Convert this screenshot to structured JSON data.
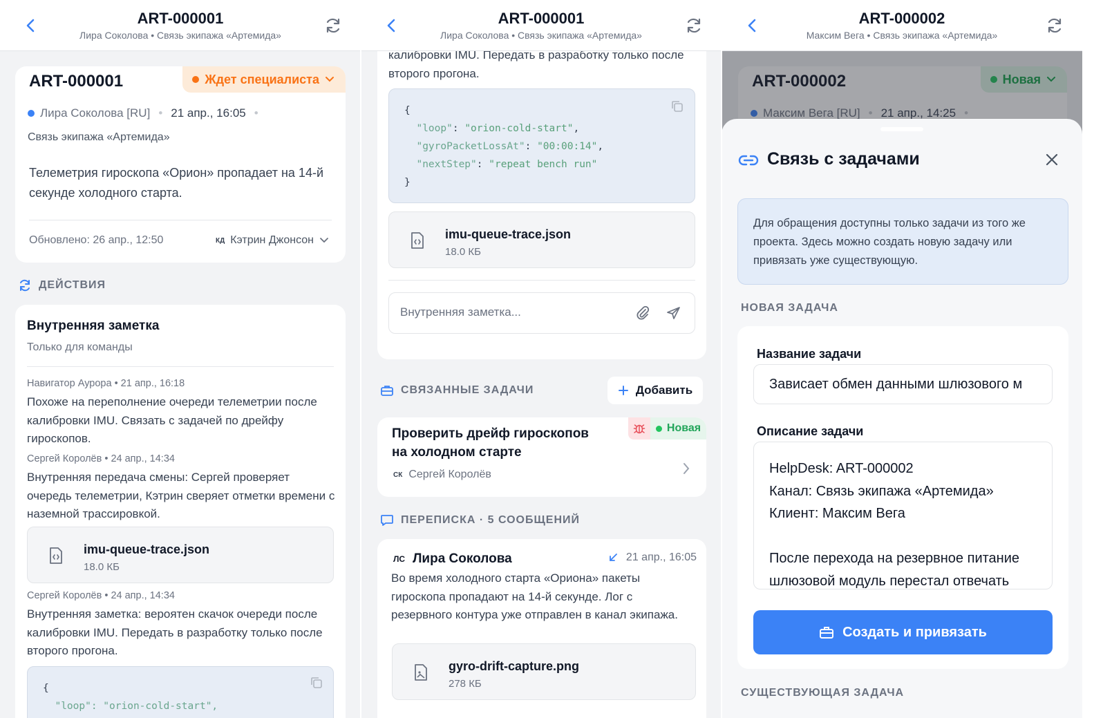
{
  "colors": {
    "accent": "#3b82f6",
    "waiting": "#f97316",
    "new": "#22c55e",
    "bug": "#e8505b"
  },
  "screen1": {
    "header": {
      "title": "ART-000001",
      "subtitle": "Лира Соколова • Связь экипажа «Артемида»"
    },
    "ticket": {
      "id": "ART-000001",
      "status": "Ждет специалиста",
      "client": "Лира Соколова [RU]",
      "date": "21 апр., 16:05",
      "channel": "Связь экипажа «Артемида»",
      "description": "Телеметрия гироскопа «Орион» пропадает на 14-й секунде холодного старта.",
      "updated": "Обновлено: 26 апр., 12:50",
      "assignee_initials": "КД",
      "assignee": "Кэтрин Джонсон"
    },
    "actions_title": "ДЕЙСТВИЯ",
    "note_panel": {
      "title": "Внутренняя заметка",
      "subtitle": "Только для команды",
      "notes": [
        {
          "meta": "Навигатор Аурора • 21 апр., 16:18",
          "text": "Похоже на переполнение очереди телеметрии после калибровки IMU. Связать с задачей по дрейфу гироскопов."
        },
        {
          "meta": "Сергей Королёв • 24 апр., 14:34",
          "text": "Внутренняя передача смены: Сергей проверяет очередь телеметрии, Кэтрин сверяет отметки времени с наземной трассировкой."
        },
        {
          "meta": "Сергей Королёв • 24 апр., 14:34",
          "text": "Внутренняя заметка: вероятен скачок очереди после калибровки IMU. Передать в разработку только после второго прогона."
        }
      ],
      "file": {
        "name": "imu-queue-trace.json",
        "size": "18.0 КБ"
      },
      "code_first_line": "{",
      "code_second_line": "  \"loop\": \"orion-cold-start\","
    }
  },
  "screen2": {
    "header": {
      "title": "ART-000001",
      "subtitle": "Лира Соколова • Связь экипажа «Артемида»"
    },
    "note_tail": "калибровки IMU. Передать в разработку только после второго прогона.",
    "code": {
      "open": "{",
      "k1": "\"loop\"",
      "v1": "\"orion-cold-start\"",
      "k2": "\"gyroPacketLossAt\"",
      "v2": "\"00:00:14\"",
      "k3": "\"nextStep\"",
      "v3": "\"repeat bench run\"",
      "close": "}"
    },
    "file": {
      "name": "imu-queue-trace.json",
      "size": "18.0 КБ"
    },
    "note_input_placeholder": "Внутренняя заметка...",
    "linked_title": "СВЯЗАННЫЕ ЗАДАЧИ",
    "add_label": "Добавить",
    "task": {
      "title": "Проверить дрейф гироскопов на холодном старте",
      "status": "Новая",
      "assignee_initials": "СК",
      "assignee": "Сергей Королёв"
    },
    "conversation_title": "ПЕРЕПИСКА · 5 СООБЩЕНИЙ",
    "message": {
      "initials": "ЛС",
      "author": "Лира Соколова",
      "date": "21 апр., 16:05",
      "text": "Во время холодного старта «Ориона» пакеты гироскопа пропадают на 14-й секунде. Лог с резервного контура уже отправлен в канал экипажа.",
      "file": {
        "name": "gyro-drift-capture.png",
        "size": "278 КБ"
      }
    }
  },
  "screen3": {
    "header": {
      "title": "ART-000002",
      "subtitle": "Максим Вега • Связь экипажа «Артемида»"
    },
    "ticket": {
      "id": "ART-000002",
      "status": "Новая",
      "client": "Максим Вега [RU]",
      "date": "21 апр., 14:25"
    },
    "sheet": {
      "title": "Связь с задачами",
      "info": "Для обращения доступны только задачи из того же проекта. Здесь можно создать новую задачу или привязать уже существующую.",
      "new_task_title": "НОВАЯ ЗАДАЧА",
      "name_label": "Название задачи",
      "name_value": "Зависает обмен данными шлюзового м",
      "desc_label": "Описание задачи",
      "desc_lines": [
        "HelpDesk: ART-000002",
        "Канал: Связь экипажа «Артемида»",
        "Клиент: Максим Вега",
        "",
        "После перехода на резервное питание",
        "шлюзовой модуль перестал отвечать"
      ],
      "create_button": "Создать и привязать",
      "existing_title": "СУЩЕСТВУЮЩАЯ ЗАДАЧА"
    }
  }
}
